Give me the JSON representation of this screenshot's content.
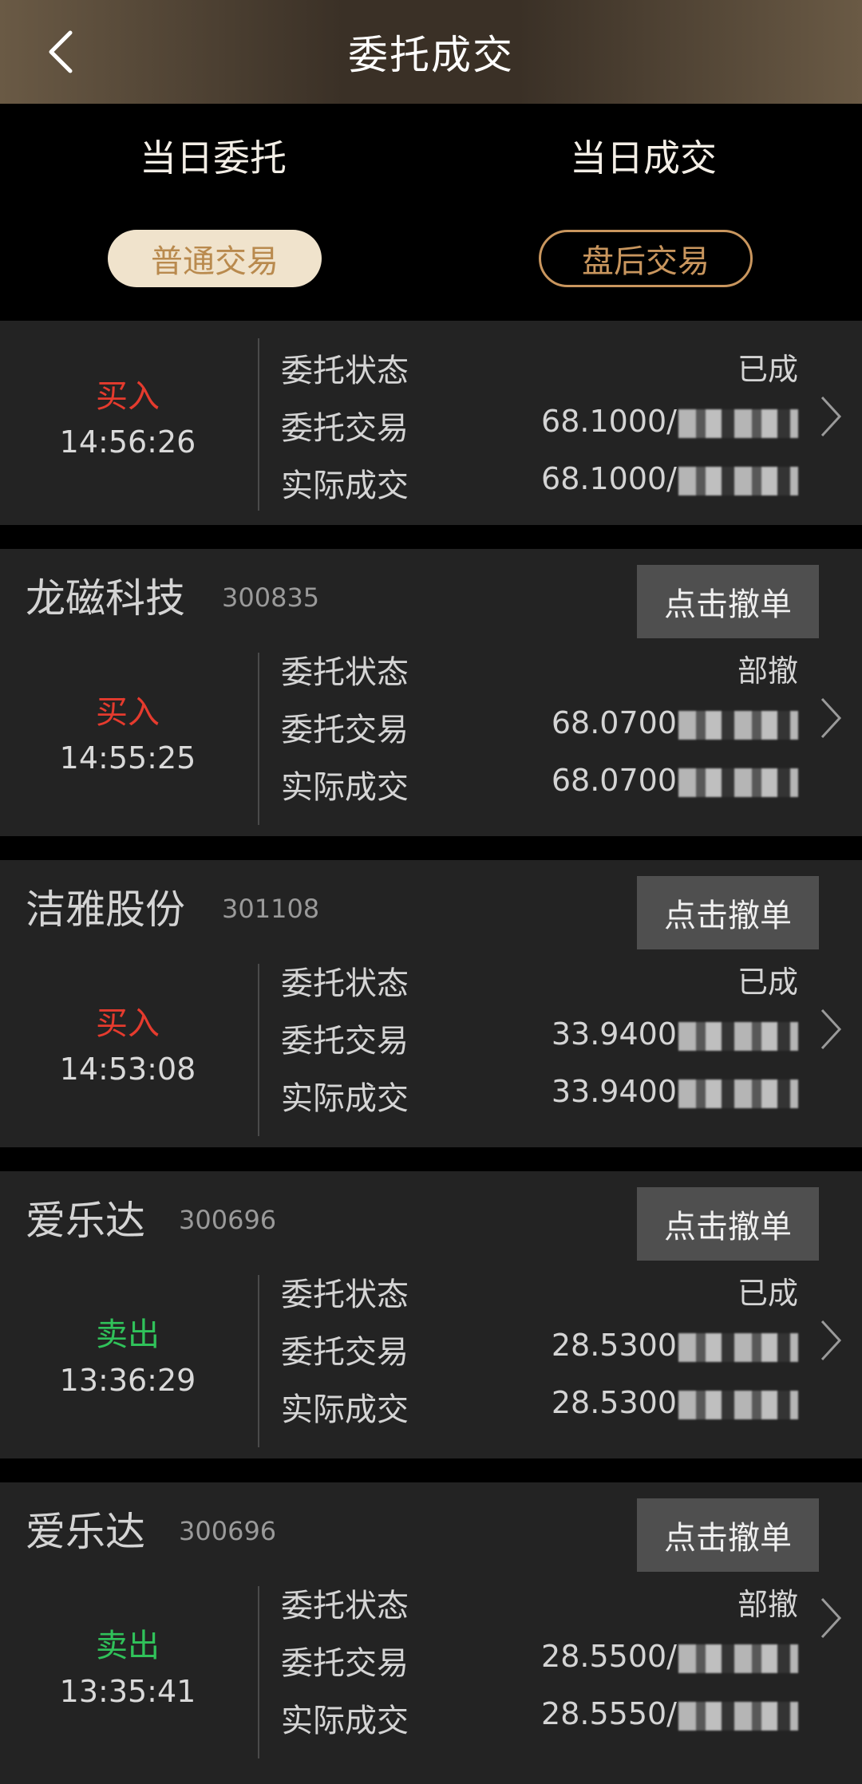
{
  "header": {
    "title": "委托成交",
    "back_icon": "chevron-left-icon"
  },
  "tabs": {
    "today_orders": "当日委托",
    "today_trades": "当日成交"
  },
  "filters": {
    "normal": "普通交易",
    "after_hours": "盘后交易"
  },
  "labels": {
    "status": "委托状态",
    "order": "委托交易",
    "actual": "实际成交",
    "cancel": "点击撤单"
  },
  "orders": [
    {
      "name": "",
      "code": "",
      "action": "买入",
      "time": "14:56:26",
      "status": "已成",
      "order_price": "68.1000/",
      "actual_price": "68.1000/"
    },
    {
      "name": "龙磁科技",
      "code": "300835",
      "action": "买入",
      "time": "14:55:25",
      "status": "部撤",
      "order_price": "68.0700",
      "actual_price": "68.0700"
    },
    {
      "name": "洁雅股份",
      "code": "301108",
      "action": "买入",
      "time": "14:53:08",
      "status": "已成",
      "order_price": "33.9400",
      "actual_price": "33.9400"
    },
    {
      "name": "爱乐达",
      "code": "300696",
      "action": "卖出",
      "time": "13:36:29",
      "status": "已成",
      "order_price": "28.5300",
      "actual_price": "28.5300"
    },
    {
      "name": "爱乐达",
      "code": "300696",
      "action": "卖出",
      "time": "13:35:41",
      "status": "部撤",
      "order_price": "28.5500/",
      "actual_price": "28.5550/"
    }
  ]
}
